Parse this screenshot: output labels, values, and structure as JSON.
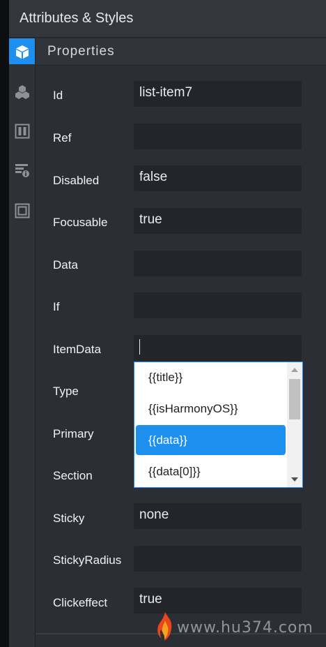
{
  "panel": {
    "title": "Attributes & Styles"
  },
  "rail": {
    "items": [
      {
        "icon": "cube-icon",
        "active": true
      },
      {
        "icon": "components-icon",
        "active": false
      },
      {
        "icon": "columns-icon",
        "active": false
      },
      {
        "icon": "event-settings-icon",
        "active": false
      },
      {
        "icon": "box-model-icon",
        "active": false
      }
    ]
  },
  "section": {
    "title": "Properties"
  },
  "properties": [
    {
      "label": "Id",
      "value": "list-item7"
    },
    {
      "label": "Ref",
      "value": ""
    },
    {
      "label": "Disabled",
      "value": "false"
    },
    {
      "label": "Focusable",
      "value": "true"
    },
    {
      "label": "Data",
      "value": ""
    },
    {
      "label": "If",
      "value": ""
    },
    {
      "label": "ItemData",
      "value": ""
    },
    {
      "label": "Type",
      "value": ""
    },
    {
      "label": "Primary",
      "value": ""
    },
    {
      "label": "Section",
      "value": ""
    },
    {
      "label": "Sticky",
      "value": "none"
    },
    {
      "label": "StickyRadius",
      "value": ""
    },
    {
      "label": "Clickeffect",
      "value": "true"
    }
  ],
  "autocomplete": {
    "options": [
      "{{title}}",
      "{{isHarmonyOS}}",
      "{{data}}",
      "{{data[0]}}"
    ],
    "selected": "{{data}}"
  },
  "watermark": {
    "text": "www.hu374.com"
  },
  "colors": {
    "accent": "#1c8fef",
    "background": "#2b2e35",
    "input": "#23252b"
  }
}
